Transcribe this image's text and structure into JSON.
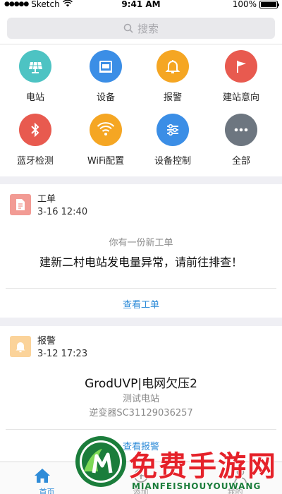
{
  "status_bar": {
    "carrier": "Sketch",
    "time": "9:41 AM",
    "battery": "100%",
    "battery_level": 1.0
  },
  "search": {
    "placeholder": "搜索"
  },
  "grid": [
    {
      "label": "电站",
      "icon": "solar-panel-icon",
      "color": "#4dc3c3"
    },
    {
      "label": "设备",
      "icon": "device-icon",
      "color": "#3b8ee6"
    },
    {
      "label": "报警",
      "icon": "bell-icon",
      "color": "#f5a623"
    },
    {
      "label": "建站意向",
      "icon": "flag-icon",
      "color": "#e85a4f"
    },
    {
      "label": "蓝牙检测",
      "icon": "bluetooth-icon",
      "color": "#e85a4f"
    },
    {
      "label": "WiFi配置",
      "icon": "wifi-icon",
      "color": "#f5a623"
    },
    {
      "label": "设备控制",
      "icon": "sliders-icon",
      "color": "#3b8ee6"
    },
    {
      "label": "全部",
      "icon": "more-icon",
      "color": "#6d7680"
    }
  ],
  "work_order": {
    "title": "工单",
    "time": "3-16 12:40",
    "subtitle": "你有一份新工单",
    "message": "建新二村电站发电量异常，请前往排查！",
    "action": "查看工单"
  },
  "alarm": {
    "title": "报警",
    "time": "3-12 17:23",
    "headline": "GrodUVP|电网欠压2",
    "station": "测试电站",
    "device": "逆变器SC31129036257",
    "action": "查看报警"
  },
  "tab_bar": {
    "tabs": [
      {
        "label": "首页",
        "active": true
      },
      {
        "label": "添加",
        "active": false
      },
      {
        "label": "我的",
        "active": false
      }
    ]
  },
  "watermark": {
    "text_cn": "免费手游网",
    "text_en": "MIANFEISHOUYOUWANG"
  },
  "colors": {
    "accent": "#2f8cd8",
    "work_order_icon": "#f29b94",
    "alarm_icon": "#fbd39a"
  }
}
